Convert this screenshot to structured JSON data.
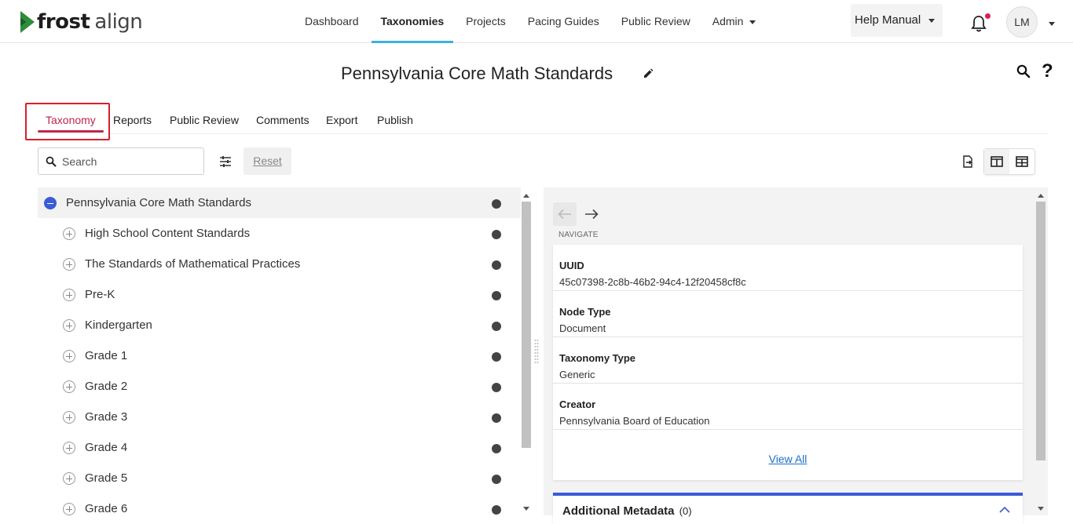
{
  "brand": {
    "bold": "frost",
    "light": "align"
  },
  "nav": {
    "items": [
      {
        "label": "Dashboard"
      },
      {
        "label": "Taxonomies"
      },
      {
        "label": "Projects"
      },
      {
        "label": "Pacing Guides"
      },
      {
        "label": "Public Review"
      },
      {
        "label": "Admin"
      }
    ],
    "active": "Taxonomies",
    "help_label": "Help Manual",
    "avatar_initials": "LM"
  },
  "page": {
    "title": "Pennsylvania Core Math Standards"
  },
  "tabs": {
    "items": [
      "Taxonomy",
      "Reports",
      "Public Review",
      "Comments",
      "Export",
      "Publish"
    ],
    "active": "Taxonomy"
  },
  "toolbar": {
    "search_placeholder": "Search",
    "reset_label": "Reset"
  },
  "tree": {
    "root": "Pennsylvania Core Math Standards",
    "children": [
      "High School Content Standards",
      "The Standards of Mathematical Practices",
      "Pre-K",
      "Kindergarten",
      "Grade 1",
      "Grade 2",
      "Grade 3",
      "Grade 4",
      "Grade 5",
      "Grade 6"
    ]
  },
  "details": {
    "navigate_label": "NAVIGATE",
    "fields": [
      {
        "label": "UUID",
        "value": "45c07398-2c8b-46b2-94c4-12f20458cf8c"
      },
      {
        "label": "Node Type",
        "value": "Document"
      },
      {
        "label": "Taxonomy Type",
        "value": "Generic"
      },
      {
        "label": "Creator",
        "value": "Pennsylvania Board of Education"
      }
    ],
    "view_all": "View All",
    "additional_metadata": {
      "title": "Additional Metadata",
      "count": "(0)"
    }
  },
  "colors": {
    "accent_tab": "#c0264c",
    "nav_underline": "#3db1dd",
    "toggle_blue": "#3c5bd6",
    "link": "#1c6fc4",
    "notif_dot": "#d8234f"
  }
}
